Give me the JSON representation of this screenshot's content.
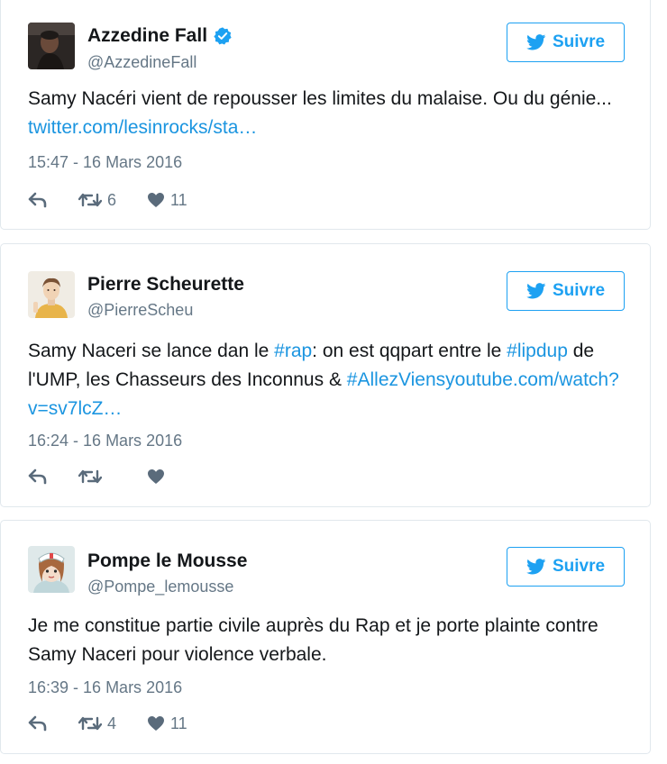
{
  "follow_label": "Suivre",
  "colors": {
    "accent": "#1da1f2",
    "link": "#1b95e0",
    "meta": "#657786",
    "border": "#e1e8ed",
    "action_icon": "#5a6b7b"
  },
  "tweets": [
    {
      "name": "Azzedine Fall",
      "verified": true,
      "handle": "@AzzedineFall",
      "text_segments": [
        {
          "type": "text",
          "value": "Samy Nacéri vient de repousser les limites du malaise. Ou du génie... "
        },
        {
          "type": "link",
          "value": "twitter.com/lesinrocks/sta…"
        }
      ],
      "timestamp": "15:47 - 16 Mars 2016",
      "retweets": "6",
      "likes": "11",
      "avatar_icon": "person-dark-photo"
    },
    {
      "name": "Pierre Scheurette",
      "verified": false,
      "handle": "@PierreScheu",
      "text_segments": [
        {
          "type": "text",
          "value": "Samy Naceri se lance dan le "
        },
        {
          "type": "hashtag",
          "value": "#rap"
        },
        {
          "type": "text",
          "value": ": on est qqpart entre le "
        },
        {
          "type": "hashtag",
          "value": "#lipdup"
        },
        {
          "type": "text",
          "value": " de l'UMP, les Chasseurs des Inconnus & "
        },
        {
          "type": "hashtag",
          "value": "#AllezViens"
        },
        {
          "type": "link",
          "value": "youtube.com/watch?v=sv7lcZ…"
        }
      ],
      "timestamp": "16:24 - 16 Mars 2016",
      "retweets": "",
      "likes": "",
      "avatar_icon": "person-illustration"
    },
    {
      "name": "Pompe le Mousse",
      "verified": false,
      "handle": "@Pompe_lemousse",
      "text_segments": [
        {
          "type": "text",
          "value": "Je me constitue partie civile auprès du Rap et je porte plainte contre Samy Naceri pour violence verbale."
        }
      ],
      "timestamp": "16:39 - 16 Mars 2016",
      "retweets": "4",
      "likes": "11",
      "avatar_icon": "nurse-cartoon"
    }
  ]
}
